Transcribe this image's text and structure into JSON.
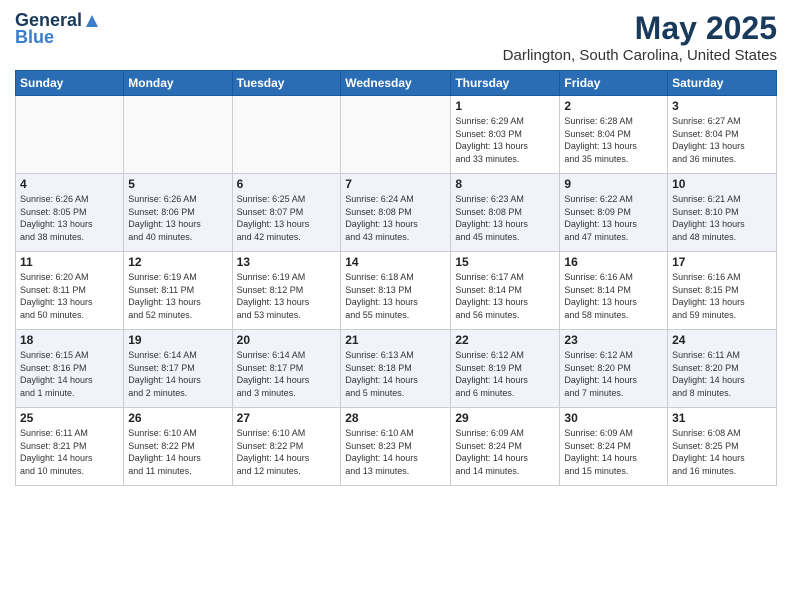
{
  "header": {
    "logo_general": "General",
    "logo_blue": "Blue",
    "month": "May 2025",
    "location": "Darlington, South Carolina, United States"
  },
  "weekdays": [
    "Sunday",
    "Monday",
    "Tuesday",
    "Wednesday",
    "Thursday",
    "Friday",
    "Saturday"
  ],
  "weeks": [
    [
      {
        "day": "",
        "info": ""
      },
      {
        "day": "",
        "info": ""
      },
      {
        "day": "",
        "info": ""
      },
      {
        "day": "",
        "info": ""
      },
      {
        "day": "1",
        "info": "Sunrise: 6:29 AM\nSunset: 8:03 PM\nDaylight: 13 hours\nand 33 minutes."
      },
      {
        "day": "2",
        "info": "Sunrise: 6:28 AM\nSunset: 8:04 PM\nDaylight: 13 hours\nand 35 minutes."
      },
      {
        "day": "3",
        "info": "Sunrise: 6:27 AM\nSunset: 8:04 PM\nDaylight: 13 hours\nand 36 minutes."
      }
    ],
    [
      {
        "day": "4",
        "info": "Sunrise: 6:26 AM\nSunset: 8:05 PM\nDaylight: 13 hours\nand 38 minutes."
      },
      {
        "day": "5",
        "info": "Sunrise: 6:26 AM\nSunset: 8:06 PM\nDaylight: 13 hours\nand 40 minutes."
      },
      {
        "day": "6",
        "info": "Sunrise: 6:25 AM\nSunset: 8:07 PM\nDaylight: 13 hours\nand 42 minutes."
      },
      {
        "day": "7",
        "info": "Sunrise: 6:24 AM\nSunset: 8:08 PM\nDaylight: 13 hours\nand 43 minutes."
      },
      {
        "day": "8",
        "info": "Sunrise: 6:23 AM\nSunset: 8:08 PM\nDaylight: 13 hours\nand 45 minutes."
      },
      {
        "day": "9",
        "info": "Sunrise: 6:22 AM\nSunset: 8:09 PM\nDaylight: 13 hours\nand 47 minutes."
      },
      {
        "day": "10",
        "info": "Sunrise: 6:21 AM\nSunset: 8:10 PM\nDaylight: 13 hours\nand 48 minutes."
      }
    ],
    [
      {
        "day": "11",
        "info": "Sunrise: 6:20 AM\nSunset: 8:11 PM\nDaylight: 13 hours\nand 50 minutes."
      },
      {
        "day": "12",
        "info": "Sunrise: 6:19 AM\nSunset: 8:11 PM\nDaylight: 13 hours\nand 52 minutes."
      },
      {
        "day": "13",
        "info": "Sunrise: 6:19 AM\nSunset: 8:12 PM\nDaylight: 13 hours\nand 53 minutes."
      },
      {
        "day": "14",
        "info": "Sunrise: 6:18 AM\nSunset: 8:13 PM\nDaylight: 13 hours\nand 55 minutes."
      },
      {
        "day": "15",
        "info": "Sunrise: 6:17 AM\nSunset: 8:14 PM\nDaylight: 13 hours\nand 56 minutes."
      },
      {
        "day": "16",
        "info": "Sunrise: 6:16 AM\nSunset: 8:14 PM\nDaylight: 13 hours\nand 58 minutes."
      },
      {
        "day": "17",
        "info": "Sunrise: 6:16 AM\nSunset: 8:15 PM\nDaylight: 13 hours\nand 59 minutes."
      }
    ],
    [
      {
        "day": "18",
        "info": "Sunrise: 6:15 AM\nSunset: 8:16 PM\nDaylight: 14 hours\nand 1 minute."
      },
      {
        "day": "19",
        "info": "Sunrise: 6:14 AM\nSunset: 8:17 PM\nDaylight: 14 hours\nand 2 minutes."
      },
      {
        "day": "20",
        "info": "Sunrise: 6:14 AM\nSunset: 8:17 PM\nDaylight: 14 hours\nand 3 minutes."
      },
      {
        "day": "21",
        "info": "Sunrise: 6:13 AM\nSunset: 8:18 PM\nDaylight: 14 hours\nand 5 minutes."
      },
      {
        "day": "22",
        "info": "Sunrise: 6:12 AM\nSunset: 8:19 PM\nDaylight: 14 hours\nand 6 minutes."
      },
      {
        "day": "23",
        "info": "Sunrise: 6:12 AM\nSunset: 8:20 PM\nDaylight: 14 hours\nand 7 minutes."
      },
      {
        "day": "24",
        "info": "Sunrise: 6:11 AM\nSunset: 8:20 PM\nDaylight: 14 hours\nand 8 minutes."
      }
    ],
    [
      {
        "day": "25",
        "info": "Sunrise: 6:11 AM\nSunset: 8:21 PM\nDaylight: 14 hours\nand 10 minutes."
      },
      {
        "day": "26",
        "info": "Sunrise: 6:10 AM\nSunset: 8:22 PM\nDaylight: 14 hours\nand 11 minutes."
      },
      {
        "day": "27",
        "info": "Sunrise: 6:10 AM\nSunset: 8:22 PM\nDaylight: 14 hours\nand 12 minutes."
      },
      {
        "day": "28",
        "info": "Sunrise: 6:10 AM\nSunset: 8:23 PM\nDaylight: 14 hours\nand 13 minutes."
      },
      {
        "day": "29",
        "info": "Sunrise: 6:09 AM\nSunset: 8:24 PM\nDaylight: 14 hours\nand 14 minutes."
      },
      {
        "day": "30",
        "info": "Sunrise: 6:09 AM\nSunset: 8:24 PM\nDaylight: 14 hours\nand 15 minutes."
      },
      {
        "day": "31",
        "info": "Sunrise: 6:08 AM\nSunset: 8:25 PM\nDaylight: 14 hours\nand 16 minutes."
      }
    ]
  ]
}
